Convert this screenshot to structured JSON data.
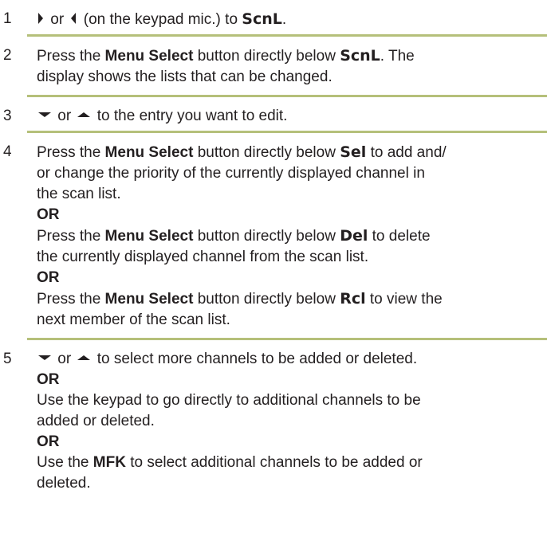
{
  "accent_rule_color": "#b5c07a",
  "steps": [
    {
      "number": "1",
      "or_word": "or",
      "text_a": "(on the keypad mic.) to",
      "display": "ScnL",
      "end": "."
    },
    {
      "number": "2",
      "text_a": "Press the",
      "button": "Menu Select",
      "text_b": "button directly below",
      "display": "ScnL",
      "line1_end": ". The",
      "line2": "display shows the lists that can be changed."
    },
    {
      "number": "3",
      "or_word": "or",
      "text_a": "to the entry you want to edit."
    },
    {
      "number": "4",
      "p1_text_a": "Press the",
      "p1_button": "Menu Select",
      "p1_text_b": "button directly below",
      "p1_display": "Sel",
      "p1_line1_end": "to add and/",
      "p1_line2": "or change the priority of the currently displayed channel in",
      "p1_line3": "the scan list.",
      "or1": "OR",
      "p2_text_a": "Press the",
      "p2_button": "Menu Select",
      "p2_text_b": "button directly below",
      "p2_display": "Del",
      "p2_line1_end": "to delete",
      "p2_line2": "the currently displayed channel from the scan list.",
      "or2": "OR",
      "p3_text_a": "Press the",
      "p3_button": "Menu Select",
      "p3_text_b": "button directly below",
      "p3_display": "Rcl",
      "p3_line1_end": "to view the",
      "p3_line2": "next member of the scan list."
    },
    {
      "number": "5",
      "or_word": "or",
      "text_a": "to select more channels to be added or deleted.",
      "or1": "OR",
      "p2_line1": "Use the keypad to go directly to additional channels to be",
      "p2_line2": "added or deleted.",
      "or2": "OR",
      "p3_text_a": "Use the",
      "p3_key": "MFK",
      "p3_line1_end": "to select additional channels to be added or",
      "p3_line2": "deleted."
    }
  ]
}
